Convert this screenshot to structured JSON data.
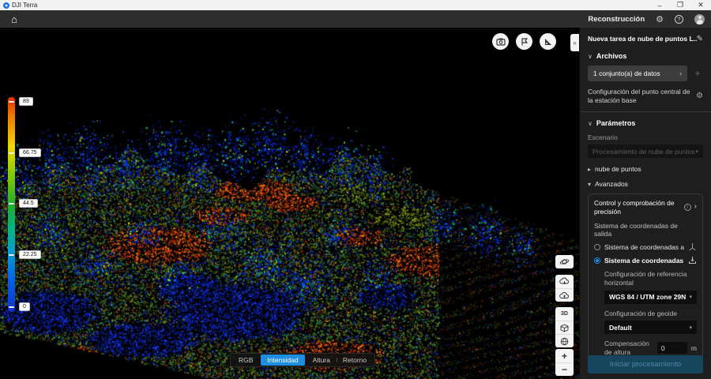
{
  "window": {
    "title": "DJI Terra",
    "controls": {
      "minimize": "–",
      "maximize": "❐",
      "close": "✕"
    }
  },
  "icons": {
    "home": "⌂",
    "gear": "⚙",
    "help": "?",
    "edit": "✎",
    "chevron_down": "∨",
    "tri_right": "▸",
    "tri_down": "▾",
    "chevron_right": "›",
    "collapse": "»",
    "plus": "+",
    "select_caret": "▾",
    "info": "i",
    "label_3d": "3D",
    "zoom_in": "+",
    "zoom_out": "−"
  },
  "appbar": {
    "mode_label": "Reconstrucción"
  },
  "viewport": {
    "colorbar": {
      "labels": [
        "89",
        "66.75",
        "44.5",
        "22.25",
        "0"
      ]
    },
    "modes": {
      "items": [
        "RGB",
        "Intensidad",
        "Altura",
        "Retorno"
      ],
      "active": "Intensidad"
    },
    "pointcloud": {
      "background": "#000000",
      "blues": [
        "#0018a8",
        "#0026d8",
        "#0b3cf0",
        "#0030b8",
        "#1648ff",
        "#001688"
      ],
      "accents": [
        "#00c853",
        "#00e676",
        "#19d2a0",
        "#00b0ff",
        "#62dd20"
      ],
      "olives": [
        "#6f7d05",
        "#55700a",
        "#8a9414",
        "#9aa81e",
        "#4e8c12"
      ],
      "greens": [
        "#3f7a0c",
        "#27560a",
        "#1f9a4a",
        "#2e7d1a"
      ],
      "reds": [
        "#c62a00",
        "#e84c00",
        "#ff6d00",
        "#9d1f00",
        "#ff9100",
        "#b33c00"
      ],
      "ground_blues": [
        "#0d2bd0",
        "#0a1fa0",
        "#1440ff",
        "#071670"
      ],
      "darks": [
        "#5a1600",
        "#6e2a00",
        "#204400",
        "#0a2a66",
        "#3c4a00",
        "#144020",
        "#401000",
        "#082050"
      ],
      "specks": [
        "#cc3300",
        "#2a8a2a",
        "#2255dd",
        "#aa8800"
      ]
    }
  },
  "panel": {
    "title": "Nueva tarea de nube de puntos L...",
    "files": {
      "header": "Archivos",
      "dataset_button": "1 conjunto(a) de datos",
      "base_station_config": "Configuración del punto central de la estación base"
    },
    "parameters": {
      "header": "Parámetros",
      "scenario_label": "Escenario",
      "scenario_value": "Procesamiento de nube de puntos",
      "pointcloud_section": "nube de puntos",
      "advanced_section": "Avanzados",
      "accuracy_control": "Control y comprobación de precisión",
      "output_crs_label": "Sistema de coordenadas de salida",
      "radio_arbitrary": "Sistema de coordenadas arbitr...",
      "radio_known": "Sistema de coordenadas conoc...",
      "horizontal_ref_label": "Configuración de referencia horizontal",
      "horizontal_ref_value": "WGS 84 / UTM zone 29N",
      "geoid_label": "Configuración de geoide",
      "geoid_value": "Default",
      "height_offset_label": "Compensación de altura",
      "height_offset_value": "0",
      "height_offset_unit": "m"
    },
    "footnote": "· · · ·",
    "start_button": "Iniciar procesamiento"
  }
}
